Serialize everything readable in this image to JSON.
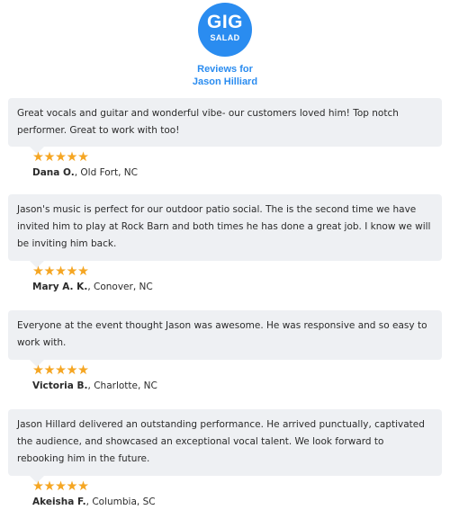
{
  "logo": {
    "top_text": "GIG",
    "bottom_text": "SALAD",
    "color": "#2a8cf0"
  },
  "header": {
    "title_line1": "Reviews for",
    "title_line2": "Jason Hilliard"
  },
  "star_color": "#f5a623",
  "reviews": [
    {
      "text": "Great vocals and guitar and wonderful vibe- our customers loved him! Top notch performer. Great to work with too!",
      "rating": 5,
      "name": "Dana O.",
      "location": "Old Fort, NC"
    },
    {
      "text": "Jason's music is perfect for our outdoor patio social. The is the second time we have invited him to play at Rock Barn and both times he has done a great job. I know we will be inviting him back.",
      "rating": 5,
      "name": "Mary A. K.",
      "location": "Conover, NC"
    },
    {
      "text": "Everyone at the event thought Jason was awesome. He was responsive and so easy to work with.",
      "rating": 5,
      "name": "Victoria B.",
      "location": "Charlotte, NC"
    },
    {
      "text": "Jason Hillard delivered an outstanding performance. He arrived punctually, captivated the audience, and showcased an exceptional vocal talent. We look forward to rebooking him in the future.",
      "rating": 5,
      "name": "Akeisha F.",
      "location": "Columbia, SC"
    }
  ]
}
